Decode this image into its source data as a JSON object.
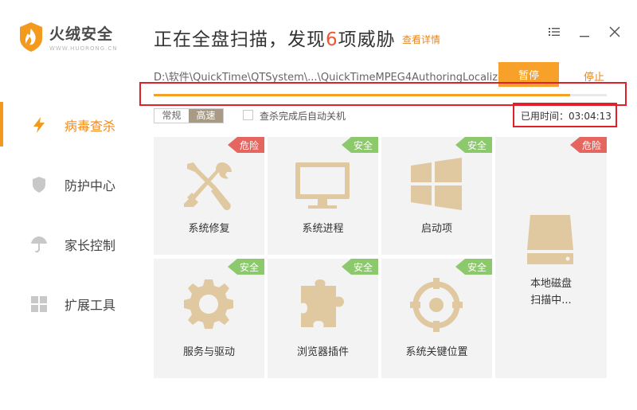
{
  "app": {
    "name": "火绒安全",
    "subtitle": "WWW.HUORONG.CN"
  },
  "sidebar": {
    "items": [
      {
        "label": "病毒查杀",
        "icon": "lightning-icon",
        "active": true
      },
      {
        "label": "防护中心",
        "icon": "shield-icon",
        "active": false
      },
      {
        "label": "家长控制",
        "icon": "umbrella-icon",
        "active": false
      },
      {
        "label": "扩展工具",
        "icon": "grid-icon",
        "active": false
      }
    ]
  },
  "header": {
    "title_prefix": "正在全盘扫描，发现",
    "threat_count": "6",
    "title_suffix": "项威胁",
    "detail_link": "查看详情"
  },
  "scan": {
    "current_path": "D:\\软件\\QuickTime\\QTSystem\\...\\QuickTimeMPEG4AuthoringLocalized.qtr",
    "pause_label": "暂停",
    "stop_label": "停止",
    "progress_fraction": 0.92,
    "mode_normal": "常规",
    "mode_fast": "高速",
    "auto_shutdown_label": "查杀完成后自动关机",
    "elapsed_label": "已用时间：03:04:13"
  },
  "tiles": [
    {
      "label": "系统修复",
      "status": "危险",
      "status_type": "danger",
      "icon": "tools-icon"
    },
    {
      "label": "系统进程",
      "status": "安全",
      "status_type": "safe",
      "icon": "monitor-icon"
    },
    {
      "label": "启动项",
      "status": "安全",
      "status_type": "safe",
      "icon": "windows-icon"
    },
    {
      "label": "本地磁盘",
      "sublabel": "扫描中...",
      "status": "危险",
      "status_type": "danger",
      "icon": "disk-icon"
    },
    {
      "label": "服务与驱动",
      "status": "安全",
      "status_type": "safe",
      "icon": "gear-icon"
    },
    {
      "label": "浏览器插件",
      "status": "安全",
      "status_type": "safe",
      "icon": "puzzle-icon"
    },
    {
      "label": "系统关键位置",
      "status": "安全",
      "status_type": "safe",
      "icon": "target-icon"
    }
  ],
  "colors": {
    "accent": "#f5a025",
    "safe": "#8cc86c",
    "danger": "#e5655f",
    "icon_tan": "#e0c9a1",
    "highlight_box": "#e0202a"
  }
}
